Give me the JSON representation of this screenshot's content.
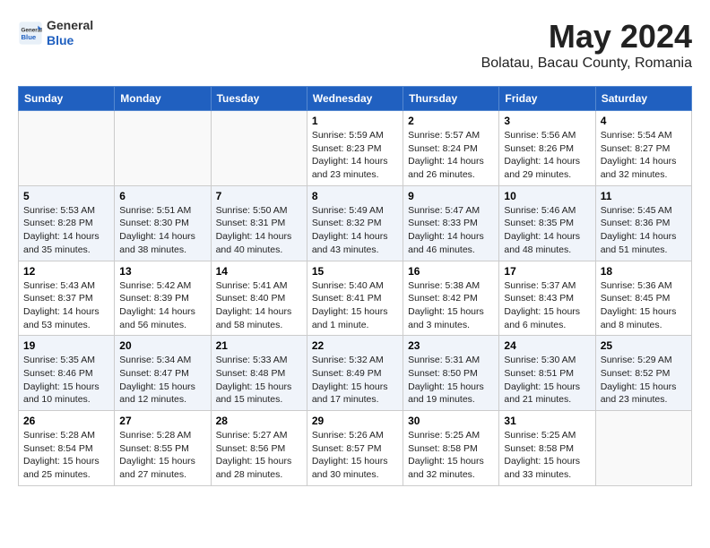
{
  "header": {
    "logo": {
      "general": "General",
      "blue": "Blue"
    },
    "title": "May 2024",
    "subtitle": "Bolatau, Bacau County, Romania"
  },
  "weekdays": [
    "Sunday",
    "Monday",
    "Tuesday",
    "Wednesday",
    "Thursday",
    "Friday",
    "Saturday"
  ],
  "weeks": [
    [
      {
        "num": "",
        "detail": ""
      },
      {
        "num": "",
        "detail": ""
      },
      {
        "num": "",
        "detail": ""
      },
      {
        "num": "1",
        "detail": "Sunrise: 5:59 AM\nSunset: 8:23 PM\nDaylight: 14 hours and 23 minutes."
      },
      {
        "num": "2",
        "detail": "Sunrise: 5:57 AM\nSunset: 8:24 PM\nDaylight: 14 hours and 26 minutes."
      },
      {
        "num": "3",
        "detail": "Sunrise: 5:56 AM\nSunset: 8:26 PM\nDaylight: 14 hours and 29 minutes."
      },
      {
        "num": "4",
        "detail": "Sunrise: 5:54 AM\nSunset: 8:27 PM\nDaylight: 14 hours and 32 minutes."
      }
    ],
    [
      {
        "num": "5",
        "detail": "Sunrise: 5:53 AM\nSunset: 8:28 PM\nDaylight: 14 hours and 35 minutes."
      },
      {
        "num": "6",
        "detail": "Sunrise: 5:51 AM\nSunset: 8:30 PM\nDaylight: 14 hours and 38 minutes."
      },
      {
        "num": "7",
        "detail": "Sunrise: 5:50 AM\nSunset: 8:31 PM\nDaylight: 14 hours and 40 minutes."
      },
      {
        "num": "8",
        "detail": "Sunrise: 5:49 AM\nSunset: 8:32 PM\nDaylight: 14 hours and 43 minutes."
      },
      {
        "num": "9",
        "detail": "Sunrise: 5:47 AM\nSunset: 8:33 PM\nDaylight: 14 hours and 46 minutes."
      },
      {
        "num": "10",
        "detail": "Sunrise: 5:46 AM\nSunset: 8:35 PM\nDaylight: 14 hours and 48 minutes."
      },
      {
        "num": "11",
        "detail": "Sunrise: 5:45 AM\nSunset: 8:36 PM\nDaylight: 14 hours and 51 minutes."
      }
    ],
    [
      {
        "num": "12",
        "detail": "Sunrise: 5:43 AM\nSunset: 8:37 PM\nDaylight: 14 hours and 53 minutes."
      },
      {
        "num": "13",
        "detail": "Sunrise: 5:42 AM\nSunset: 8:39 PM\nDaylight: 14 hours and 56 minutes."
      },
      {
        "num": "14",
        "detail": "Sunrise: 5:41 AM\nSunset: 8:40 PM\nDaylight: 14 hours and 58 minutes."
      },
      {
        "num": "15",
        "detail": "Sunrise: 5:40 AM\nSunset: 8:41 PM\nDaylight: 15 hours and 1 minute."
      },
      {
        "num": "16",
        "detail": "Sunrise: 5:38 AM\nSunset: 8:42 PM\nDaylight: 15 hours and 3 minutes."
      },
      {
        "num": "17",
        "detail": "Sunrise: 5:37 AM\nSunset: 8:43 PM\nDaylight: 15 hours and 6 minutes."
      },
      {
        "num": "18",
        "detail": "Sunrise: 5:36 AM\nSunset: 8:45 PM\nDaylight: 15 hours and 8 minutes."
      }
    ],
    [
      {
        "num": "19",
        "detail": "Sunrise: 5:35 AM\nSunset: 8:46 PM\nDaylight: 15 hours and 10 minutes."
      },
      {
        "num": "20",
        "detail": "Sunrise: 5:34 AM\nSunset: 8:47 PM\nDaylight: 15 hours and 12 minutes."
      },
      {
        "num": "21",
        "detail": "Sunrise: 5:33 AM\nSunset: 8:48 PM\nDaylight: 15 hours and 15 minutes."
      },
      {
        "num": "22",
        "detail": "Sunrise: 5:32 AM\nSunset: 8:49 PM\nDaylight: 15 hours and 17 minutes."
      },
      {
        "num": "23",
        "detail": "Sunrise: 5:31 AM\nSunset: 8:50 PM\nDaylight: 15 hours and 19 minutes."
      },
      {
        "num": "24",
        "detail": "Sunrise: 5:30 AM\nSunset: 8:51 PM\nDaylight: 15 hours and 21 minutes."
      },
      {
        "num": "25",
        "detail": "Sunrise: 5:29 AM\nSunset: 8:52 PM\nDaylight: 15 hours and 23 minutes."
      }
    ],
    [
      {
        "num": "26",
        "detail": "Sunrise: 5:28 AM\nSunset: 8:54 PM\nDaylight: 15 hours and 25 minutes."
      },
      {
        "num": "27",
        "detail": "Sunrise: 5:28 AM\nSunset: 8:55 PM\nDaylight: 15 hours and 27 minutes."
      },
      {
        "num": "28",
        "detail": "Sunrise: 5:27 AM\nSunset: 8:56 PM\nDaylight: 15 hours and 28 minutes."
      },
      {
        "num": "29",
        "detail": "Sunrise: 5:26 AM\nSunset: 8:57 PM\nDaylight: 15 hours and 30 minutes."
      },
      {
        "num": "30",
        "detail": "Sunrise: 5:25 AM\nSunset: 8:58 PM\nDaylight: 15 hours and 32 minutes."
      },
      {
        "num": "31",
        "detail": "Sunrise: 5:25 AM\nSunset: 8:58 PM\nDaylight: 15 hours and 33 minutes."
      },
      {
        "num": "",
        "detail": ""
      }
    ]
  ]
}
